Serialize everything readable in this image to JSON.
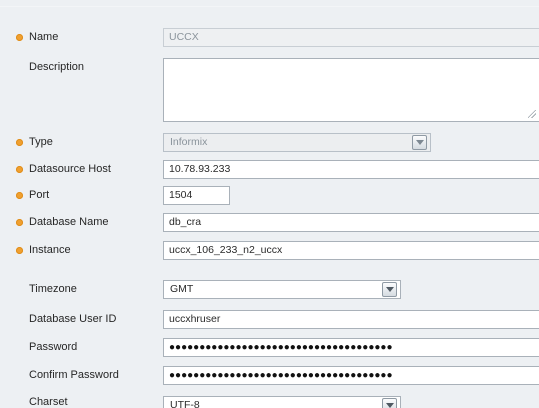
{
  "form": {
    "name": {
      "label": "Name",
      "value": "UCCX",
      "required": true
    },
    "description": {
      "label": "Description",
      "value": ""
    },
    "type": {
      "label": "Type",
      "value": "Informix",
      "required": true
    },
    "datasource_host": {
      "label": "Datasource Host",
      "value": "10.78.93.233",
      "required": true
    },
    "port": {
      "label": "Port",
      "value": "1504",
      "required": true
    },
    "database_name": {
      "label": "Database Name",
      "value": "db_cra",
      "required": true
    },
    "instance": {
      "label": "Instance",
      "value": "uccx_106_233_n2_uccx",
      "required": true
    },
    "timezone": {
      "label": "Timezone",
      "value": "GMT"
    },
    "database_user_id": {
      "label": "Database User ID",
      "value": "uccxhruser"
    },
    "password": {
      "label": "Password",
      "value": "●●●●●●●●●●●●●●●●●●●●●●●●●●●●●●●●●●●●●"
    },
    "confirm_password": {
      "label": "Confirm Password",
      "value": "●●●●●●●●●●●●●●●●●●●●●●●●●●●●●●●●●●●●●"
    },
    "charset": {
      "label": "Charset",
      "value": "UTF-8"
    }
  },
  "colors": {
    "required_marker": "#f0a030",
    "background": "#edf0f3",
    "field_border": "#a9b1b9"
  },
  "icons": {
    "required": "required-dot-icon",
    "dropdown": "chevron-down-icon",
    "resize": "resize-grip-icon"
  }
}
